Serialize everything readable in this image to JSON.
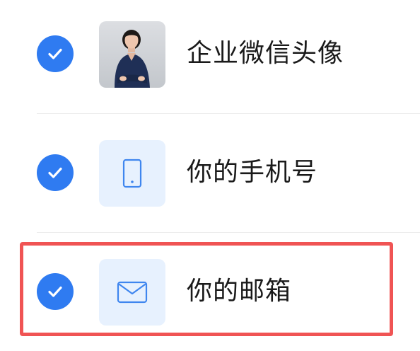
{
  "colors": {
    "accent": "#2f7bf1",
    "icon_bg": "#e7f1fe",
    "highlight": "#f05454",
    "divider": "#ececec"
  },
  "items": [
    {
      "label": "企业微信头像",
      "checked": true,
      "thumb": "avatar-photo"
    },
    {
      "label": "你的手机号",
      "checked": true,
      "thumb": "phone-icon"
    },
    {
      "label": "你的邮箱",
      "checked": true,
      "thumb": "mail-icon"
    }
  ]
}
